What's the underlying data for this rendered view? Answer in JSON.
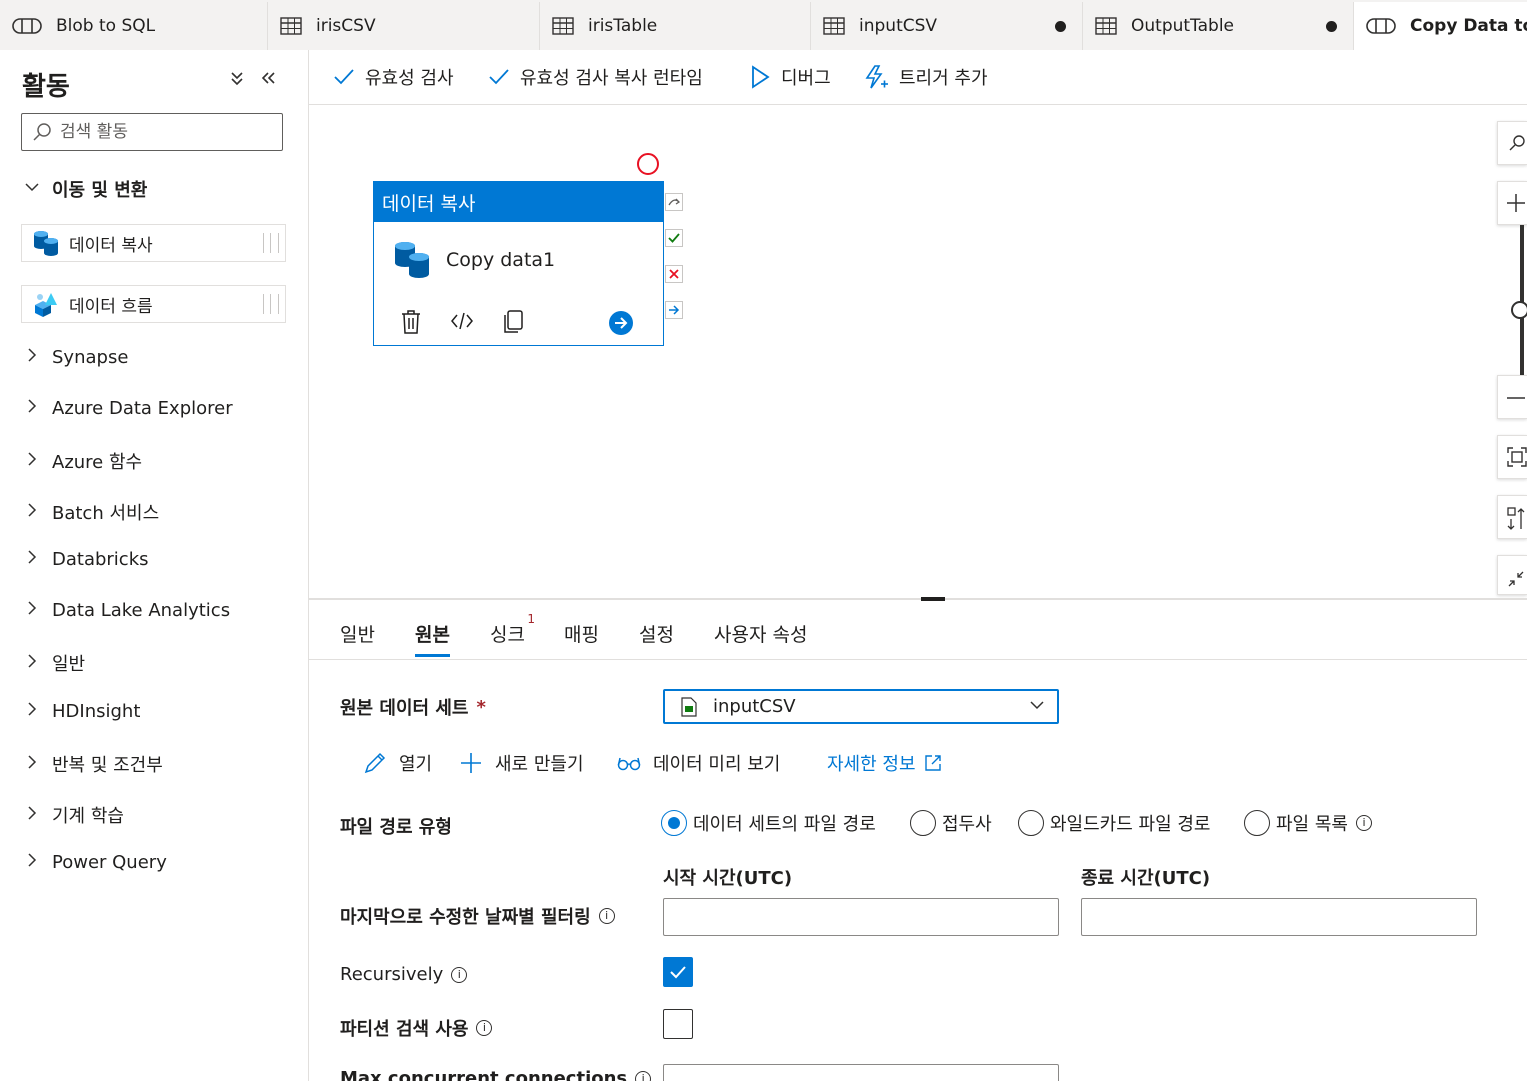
{
  "tabs": [
    {
      "label": "Blob to SQL",
      "icon": "pipeline-icon",
      "dirty": false,
      "active": false
    },
    {
      "label": "irisCSV",
      "icon": "table-icon",
      "dirty": false,
      "active": false
    },
    {
      "label": "irisTable",
      "icon": "table-icon",
      "dirty": false,
      "active": false
    },
    {
      "label": "inputCSV",
      "icon": "table-icon",
      "dirty": true,
      "active": false
    },
    {
      "label": "OutputTable",
      "icon": "table-icon",
      "dirty": true,
      "active": false
    },
    {
      "label": "Copy Data to",
      "icon": "pipeline-icon",
      "dirty": false,
      "active": true
    }
  ],
  "sidebar": {
    "title": "활동",
    "search_placeholder": "검색 활동",
    "expanded_group": "이동 및 변환",
    "items": [
      {
        "label": "데이터 복사",
        "icon": "copy-data-icon"
      },
      {
        "label": "데이터 흐름",
        "icon": "data-flow-icon"
      }
    ],
    "groups": [
      "Synapse",
      "Azure Data Explorer",
      "Azure 함수",
      "Batch 서비스",
      "Databricks",
      "Data Lake Analytics",
      "일반",
      "HDInsight",
      "반복 및 조건부",
      "기계 학습",
      "Power Query"
    ]
  },
  "toolbar": {
    "validate": "유효성 검사",
    "validate_runtime": "유효성 검사 복사 런타임",
    "debug": "디버그",
    "add_trigger": "트리거 추가"
  },
  "canvas": {
    "node_type": "데이터 복사",
    "node_name": "Copy data1"
  },
  "props": {
    "tabs": [
      "일반",
      "원본",
      "싱크",
      "매핑",
      "설정",
      "사용자 속성"
    ],
    "active_tab": "원본",
    "sink_badge": "1",
    "source_dataset_label": "원본 데이터 세트",
    "required_mark": "*",
    "source_dataset_value": "inputCSV",
    "open": "열기",
    "new": "새로 만들기",
    "preview": "데이터 미리 보기",
    "learn_more": "자세한 정보",
    "file_path_type_label": "파일 경로 유형",
    "file_path_options": [
      "데이터 세트의 파일 경로",
      "접두사",
      "와일드카드 파일 경로",
      "파일 목록"
    ],
    "file_path_selected": "데이터 세트의 파일 경로",
    "start_time_label": "시작 시간(UTC)",
    "end_time_label": "종료 시간(UTC)",
    "filter_label": "마지막으로 수정한 날짜별 필터링",
    "recursively_label": "Recursively",
    "recursively_checked": true,
    "partition_label": "파티션 검색 사용",
    "partition_checked": false,
    "max_conn_label": "Max concurrent connections"
  },
  "colors": {
    "accent": "#0078d4",
    "error": "#e81123",
    "success": "#107c10"
  }
}
